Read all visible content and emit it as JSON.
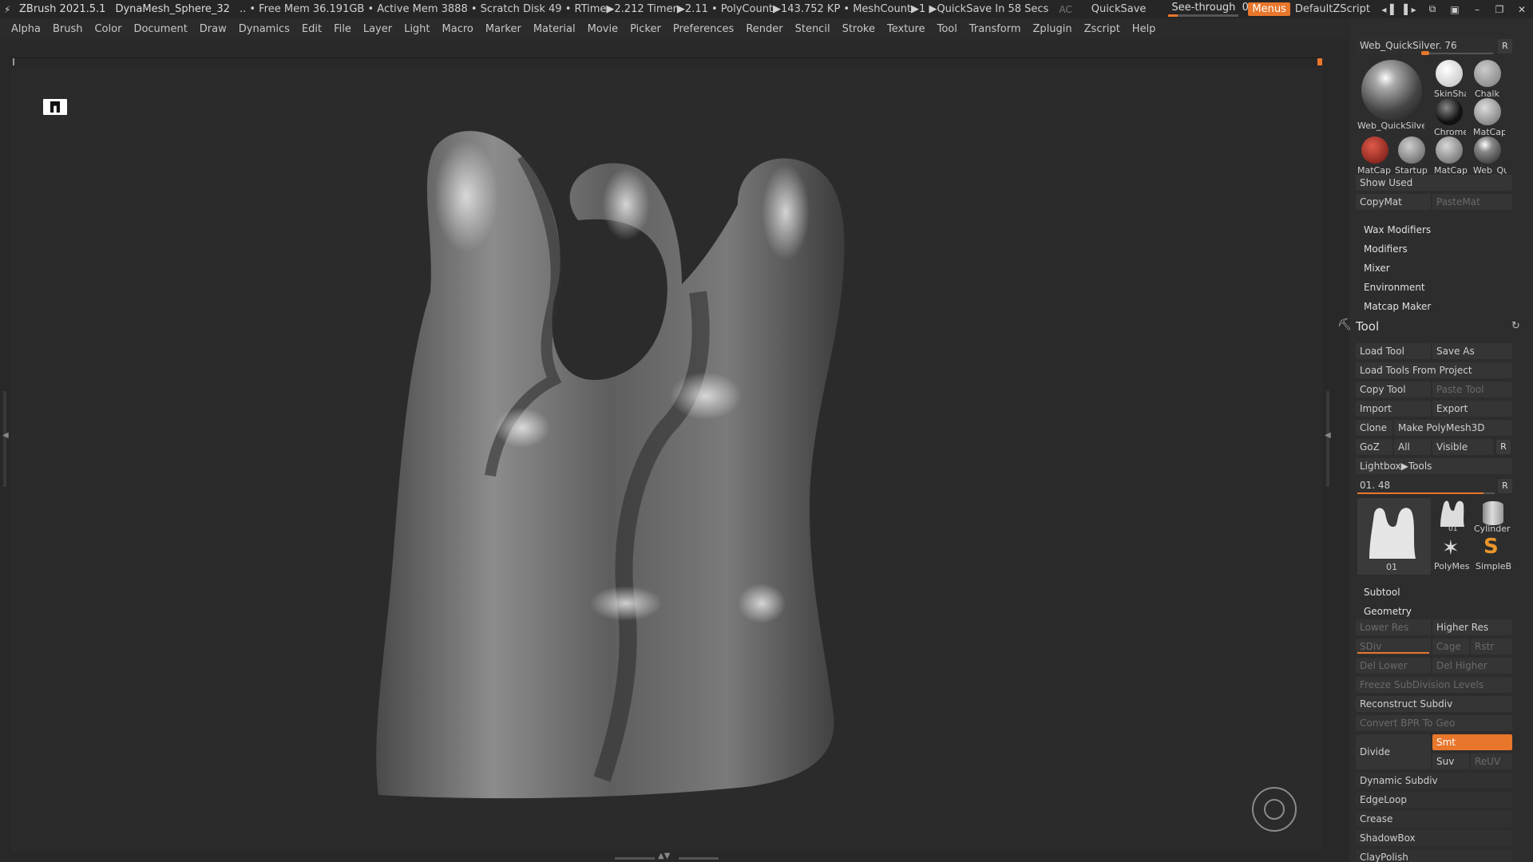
{
  "titlebar": {
    "app": "ZBrush 2021.5.1",
    "doc": "DynaMesh_Sphere_32",
    "stats": ".. • Free Mem 36.191GB • Active Mem 3888 • Scratch Disk 49 •  RTime▶2.212 Timer▶2.11 • PolyCount▶143.752 KP  • MeshCount▶1  ▶QuickSave In 58 Secs",
    "ac": "AC",
    "quicksave": "QuickSave",
    "see_through_label": "See-through",
    "see_through_value": "0",
    "see_through_fraction": 0,
    "menus": "Menus",
    "script": "DefaultZScript"
  },
  "menubar": [
    "Alpha",
    "Brush",
    "Color",
    "Document",
    "Draw",
    "Dynamics",
    "Edit",
    "File",
    "Layer",
    "Light",
    "Macro",
    "Marker",
    "Material",
    "Movie",
    "Picker",
    "Preferences",
    "Render",
    "Stencil",
    "Stroke",
    "Texture",
    "Tool",
    "Transform",
    "Zplugin",
    "Zscript",
    "Help"
  ],
  "material": {
    "current": "Web_QuickSilver. 76",
    "r": "R",
    "thumbs": [
      "Web_QuickSilver",
      "SkinSha",
      "Chalk",
      "Chrome",
      "MatCap",
      "MatCap",
      "StartupI",
      "MatCap",
      "Web_Qu"
    ],
    "show_used": "Show Used",
    "copy": "CopyMat",
    "paste": "PasteMat",
    "sections": [
      "Wax Modifiers",
      "Modifiers",
      "Mixer",
      "Environment",
      "Matcap Maker"
    ]
  },
  "tool": {
    "title": "Tool",
    "load": "Load Tool",
    "save_as": "Save As",
    "load_project": "Load Tools From Project",
    "copy": "Copy Tool",
    "paste": "Paste Tool",
    "import": "Import",
    "export": "Export",
    "clone": "Clone",
    "make_poly": "Make PolyMesh3D",
    "goz": "GoZ",
    "all": "All",
    "visible": "Visible",
    "r": "R",
    "lightbox": "Lightbox▶Tools",
    "current": "01. 48",
    "slider_fraction": 0.92,
    "thumbs": [
      "01",
      "01",
      "Cylinder",
      "PolyMes",
      "SimpleB"
    ]
  },
  "subtool": "Subtool",
  "geometry": {
    "title": "Geometry",
    "lower_res": "Lower Res",
    "higher_res": "Higher Res",
    "sdiv": "SDiv",
    "cage": "Cage",
    "rstr": "Rstr",
    "del_lower": "Del Lower",
    "del_higher": "Del Higher",
    "freeze": "Freeze SubDivision Levels",
    "reconstruct": "Reconstruct Subdiv",
    "convert": "Convert BPR To Geo",
    "divide": "Divide",
    "smt": "Smt",
    "suv": "Suv",
    "reuv": "ReUV",
    "more": [
      "Dynamic Subdiv",
      "EdgeLoop",
      "Crease",
      "ShadowBox",
      "ClayPolish"
    ]
  },
  "colors": {
    "accent": "#e8762b",
    "panel": "#2d2d2d",
    "viewport": "#2b2b2b"
  }
}
